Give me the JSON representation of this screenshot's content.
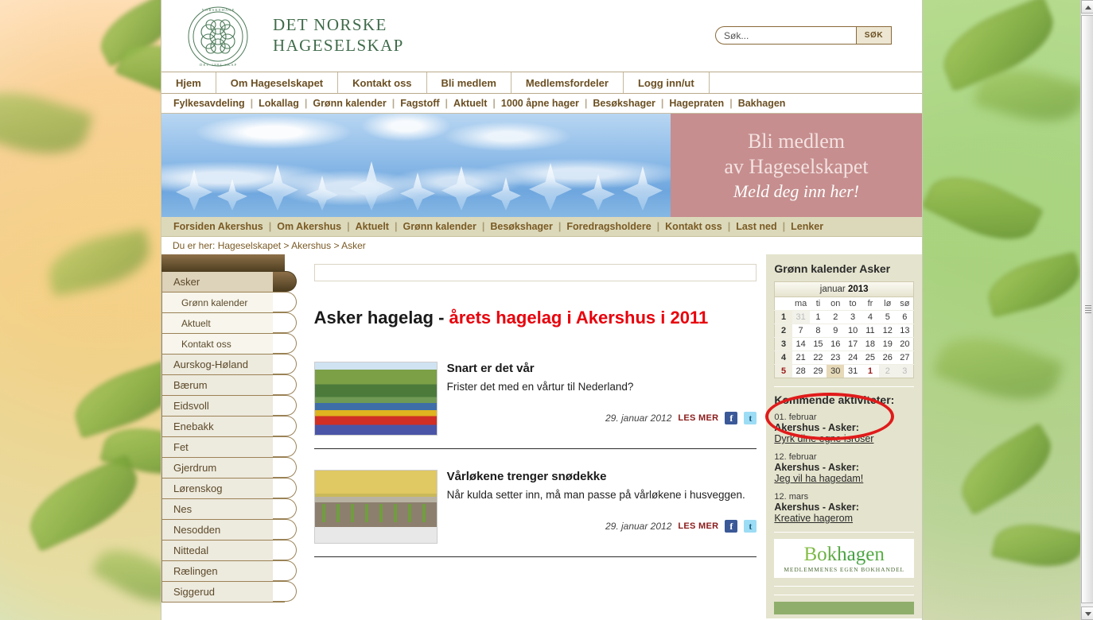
{
  "header": {
    "logo_title_line1": "DET NORSKE",
    "logo_title_line2": "HAGESELSKAP",
    "search_placeholder": "Søk...",
    "search_value": "",
    "search_button": "SØK"
  },
  "main_nav": [
    {
      "label": "Hjem"
    },
    {
      "label": "Om Hageselskapet"
    },
    {
      "label": "Kontakt oss"
    },
    {
      "label": "Bli medlem"
    },
    {
      "label": "Medlemsfordeler"
    },
    {
      "label": "Logg inn/ut"
    }
  ],
  "sub_nav": [
    {
      "label": "Fylkesavdeling"
    },
    {
      "label": "Lokallag"
    },
    {
      "label": "Grønn kalender"
    },
    {
      "label": "Fagstoff"
    },
    {
      "label": "Aktuelt"
    },
    {
      "label": "1000 åpne hager"
    },
    {
      "label": "Besøkshager"
    },
    {
      "label": "Hagepraten"
    },
    {
      "label": "Bakhagen"
    }
  ],
  "banner": {
    "member_line1": "Bli medlem",
    "member_line2": "av Hageselskapet",
    "member_line3": "Meld deg inn her!"
  },
  "local_nav": [
    {
      "label": "Forsiden Akershus"
    },
    {
      "label": "Om Akershus"
    },
    {
      "label": "Aktuelt"
    },
    {
      "label": "Grønn kalender"
    },
    {
      "label": "Besøkshager"
    },
    {
      "label": "Foredragsholdere"
    },
    {
      "label": "Kontakt oss"
    },
    {
      "label": "Last ned"
    },
    {
      "label": "Lenker"
    }
  ],
  "breadcrumb": "Du er her: Hageselskapet > Akershus > Asker",
  "sidebar": {
    "items": [
      {
        "label": "Asker",
        "level": 1,
        "active": true
      },
      {
        "label": "Grønn kalender",
        "level": 2,
        "active": false
      },
      {
        "label": "Aktuelt",
        "level": 2,
        "active": false
      },
      {
        "label": "Kontakt oss",
        "level": 2,
        "active": false
      },
      {
        "label": "Aurskog-Høland",
        "level": 1,
        "active": false
      },
      {
        "label": "Bærum",
        "level": 1,
        "active": false
      },
      {
        "label": "Eidsvoll",
        "level": 1,
        "active": false
      },
      {
        "label": "Enebakk",
        "level": 1,
        "active": false
      },
      {
        "label": "Fet",
        "level": 1,
        "active": false
      },
      {
        "label": "Gjerdrum",
        "level": 1,
        "active": false
      },
      {
        "label": "Lørenskog",
        "level": 1,
        "active": false
      },
      {
        "label": "Nes",
        "level": 1,
        "active": false
      },
      {
        "label": "Nesodden",
        "level": 1,
        "active": false
      },
      {
        "label": "Nittedal",
        "level": 1,
        "active": false
      },
      {
        "label": "Rælingen",
        "level": 1,
        "active": false
      },
      {
        "label": "Siggerud",
        "level": 1,
        "active": false
      }
    ]
  },
  "content": {
    "title_black": "Asker hagelag - ",
    "title_red": "årets hagelag i Akershus i 2011",
    "articles": [
      {
        "heading": "Snart er det vår",
        "lead": "Frister det med en vårtur til Nederland?",
        "date": "29. januar 2012",
        "read_more": "LES MER",
        "facebook_icon": "facebook-icon",
        "twitter_icon": "twitter-icon",
        "thumb": "spring-garden-tulips"
      },
      {
        "heading": "Vårløkene trenger snødekke",
        "lead": "Når kulda setter inn, må man passe på vårløkene i husveggen.",
        "date": "29. januar 2012",
        "read_more": "LES MER",
        "facebook_icon": "facebook-icon",
        "twitter_icon": "twitter-icon",
        "thumb": "sprouting-bulbs-snow"
      }
    ]
  },
  "right": {
    "calendar_heading": "Grønn kalender Asker",
    "calendar": {
      "month": "januar",
      "year": "2013",
      "weekday_headers": [
        "",
        "ma",
        "ti",
        "on",
        "to",
        "fr",
        "lø",
        "sø"
      ],
      "weeks": [
        {
          "week": "1",
          "days": [
            {
              "n": "31",
              "mute": true
            },
            {
              "n": "1"
            },
            {
              "n": "2"
            },
            {
              "n": "3"
            },
            {
              "n": "4"
            },
            {
              "n": "5"
            },
            {
              "n": "6"
            }
          ]
        },
        {
          "week": "2",
          "days": [
            {
              "n": "7"
            },
            {
              "n": "8"
            },
            {
              "n": "9"
            },
            {
              "n": "10"
            },
            {
              "n": "11"
            },
            {
              "n": "12"
            },
            {
              "n": "13"
            }
          ]
        },
        {
          "week": "3",
          "days": [
            {
              "n": "14"
            },
            {
              "n": "15"
            },
            {
              "n": "16"
            },
            {
              "n": "17"
            },
            {
              "n": "18"
            },
            {
              "n": "19"
            },
            {
              "n": "20"
            }
          ]
        },
        {
          "week": "4",
          "days": [
            {
              "n": "21"
            },
            {
              "n": "22"
            },
            {
              "n": "23"
            },
            {
              "n": "24"
            },
            {
              "n": "25"
            },
            {
              "n": "26"
            },
            {
              "n": "27"
            }
          ]
        },
        {
          "week": "5",
          "hot": true,
          "days": [
            {
              "n": "28"
            },
            {
              "n": "29"
            },
            {
              "n": "30",
              "today": true
            },
            {
              "n": "31"
            },
            {
              "n": "1",
              "hot": true
            },
            {
              "n": "2",
              "mute": true
            },
            {
              "n": "3",
              "mute": true
            }
          ]
        }
      ]
    },
    "activities_heading": "Kommende aktiviteter:",
    "activities": [
      {
        "date": "01. februar",
        "org": "Akershus - Asker:",
        "link": "Dyrk dine egne isroser",
        "highlighted": true
      },
      {
        "date": "12. februar",
        "org": "Akershus - Asker:",
        "link": "Jeg vil ha hagedam!",
        "highlighted": false
      },
      {
        "date": "12. mars",
        "org": "Akershus - Asker:",
        "link": "Kreative hagerom",
        "highlighted": false
      }
    ],
    "bokhagen": {
      "name": "Bokhagen",
      "tagline": "MEDLEMMENES EGEN BOKHANDEL"
    }
  },
  "colors": {
    "brand_green": "#3f6b4a",
    "nav_brown": "#6b4f22",
    "accent_red": "#e8000b",
    "annotation_red": "#e01b1b",
    "local_nav_bg": "#dcd9bb",
    "right_col_bg": "#e4e3cd",
    "member_banner_bg": "#c68e8e"
  }
}
